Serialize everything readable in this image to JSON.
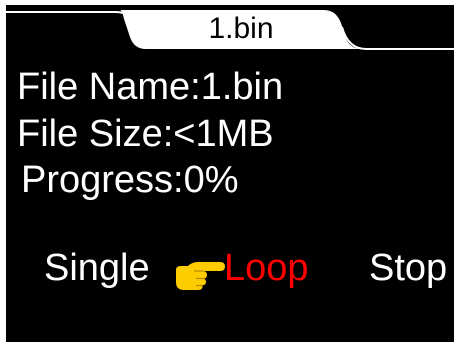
{
  "tab": {
    "title": "1.bin"
  },
  "file_info": {
    "name_text": "File Name:1.bin",
    "size_text": "File Size:<1MB",
    "progress_text": "Progress:0%"
  },
  "modes": {
    "single_label": "Single",
    "loop_label": "Loop",
    "stop_label": "Stop",
    "selected": "Loop",
    "pointer_icon": "pointing-hand-icon"
  },
  "colors": {
    "background": "#000000",
    "text": "#ffffff",
    "selected_text": "#ff0000",
    "pointer": "#ffcc00",
    "tab": "#ffffff"
  }
}
